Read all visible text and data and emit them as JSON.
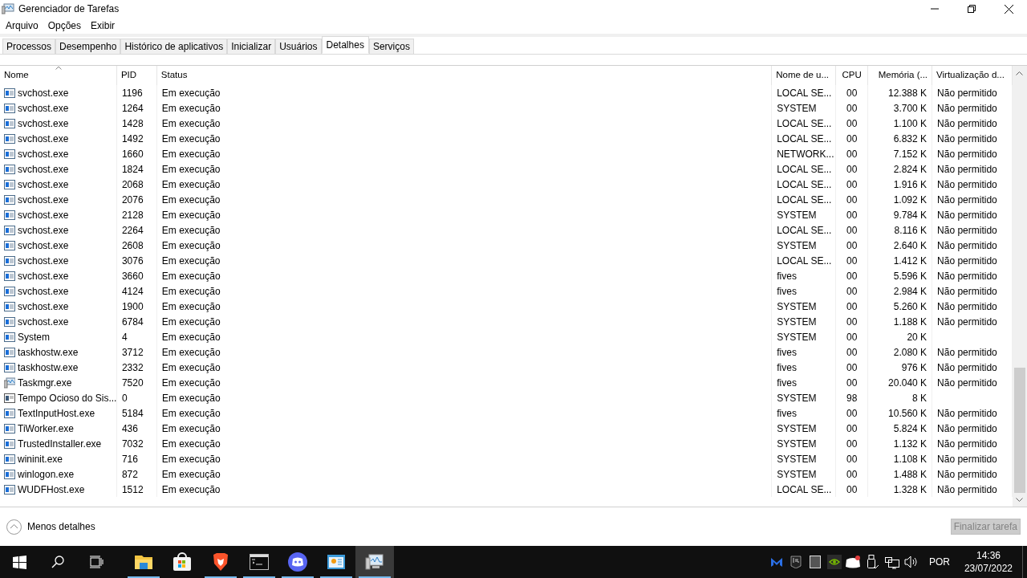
{
  "window": {
    "title": "Gerenciador de Tarefas"
  },
  "menu": [
    "Arquivo",
    "Opções",
    "Exibir"
  ],
  "tabs": [
    {
      "label": "Processos",
      "selected": false
    },
    {
      "label": "Desempenho",
      "selected": false
    },
    {
      "label": "Histórico de aplicativos",
      "selected": false
    },
    {
      "label": "Inicializar",
      "selected": false
    },
    {
      "label": "Usuários",
      "selected": false
    },
    {
      "label": "Detalhes",
      "selected": true
    },
    {
      "label": "Serviços",
      "selected": false
    }
  ],
  "table": {
    "columns": [
      "Nome",
      "PID",
      "Status",
      "Nome de u...",
      "CPU",
      "Memória (...",
      "Virtualização d..."
    ],
    "rows": [
      {
        "kind": "app",
        "cells": [
          "svchost.exe",
          "1196",
          "Em execução",
          "LOCAL SE...",
          "00",
          "12.388 K",
          "Não permitido"
        ]
      },
      {
        "kind": "app",
        "cells": [
          "svchost.exe",
          "1264",
          "Em execução",
          "SYSTEM",
          "00",
          "3.700 K",
          "Não permitido"
        ]
      },
      {
        "kind": "app",
        "cells": [
          "svchost.exe",
          "1428",
          "Em execução",
          "LOCAL SE...",
          "00",
          "1.100 K",
          "Não permitido"
        ]
      },
      {
        "kind": "app",
        "cells": [
          "svchost.exe",
          "1492",
          "Em execução",
          "LOCAL SE...",
          "00",
          "6.832 K",
          "Não permitido"
        ]
      },
      {
        "kind": "app",
        "cells": [
          "svchost.exe",
          "1660",
          "Em execução",
          "NETWORK...",
          "00",
          "7.152 K",
          "Não permitido"
        ]
      },
      {
        "kind": "app",
        "cells": [
          "svchost.exe",
          "1824",
          "Em execução",
          "LOCAL SE...",
          "00",
          "2.824 K",
          "Não permitido"
        ]
      },
      {
        "kind": "app",
        "cells": [
          "svchost.exe",
          "2068",
          "Em execução",
          "LOCAL SE...",
          "00",
          "1.916 K",
          "Não permitido"
        ]
      },
      {
        "kind": "app",
        "cells": [
          "svchost.exe",
          "2076",
          "Em execução",
          "LOCAL SE...",
          "00",
          "1.092 K",
          "Não permitido"
        ]
      },
      {
        "kind": "app",
        "cells": [
          "svchost.exe",
          "2128",
          "Em execução",
          "SYSTEM",
          "00",
          "9.784 K",
          "Não permitido"
        ]
      },
      {
        "kind": "app",
        "cells": [
          "svchost.exe",
          "2264",
          "Em execução",
          "LOCAL SE...",
          "00",
          "8.116 K",
          "Não permitido"
        ]
      },
      {
        "kind": "app",
        "cells": [
          "svchost.exe",
          "2608",
          "Em execução",
          "SYSTEM",
          "00",
          "2.640 K",
          "Não permitido"
        ]
      },
      {
        "kind": "app",
        "cells": [
          "svchost.exe",
          "3076",
          "Em execução",
          "LOCAL SE...",
          "00",
          "1.412 K",
          "Não permitido"
        ]
      },
      {
        "kind": "app",
        "cells": [
          "svchost.exe",
          "3660",
          "Em execução",
          "fives",
          "00",
          "5.596 K",
          "Não permitido"
        ]
      },
      {
        "kind": "app",
        "cells": [
          "svchost.exe",
          "4124",
          "Em execução",
          "fives",
          "00",
          "2.984 K",
          "Não permitido"
        ]
      },
      {
        "kind": "app",
        "cells": [
          "svchost.exe",
          "1900",
          "Em execução",
          "SYSTEM",
          "00",
          "5.260 K",
          "Não permitido"
        ]
      },
      {
        "kind": "app",
        "cells": [
          "svchost.exe",
          "6784",
          "Em execução",
          "SYSTEM",
          "00",
          "1.188 K",
          "Não permitido"
        ]
      },
      {
        "kind": "app",
        "cells": [
          "System",
          "4",
          "Em execução",
          "SYSTEM",
          "00",
          "20 K",
          ""
        ]
      },
      {
        "kind": "app",
        "cells": [
          "taskhostw.exe",
          "3712",
          "Em execução",
          "fives",
          "00",
          "2.080 K",
          "Não permitido"
        ]
      },
      {
        "kind": "app",
        "cells": [
          "taskhostw.exe",
          "2332",
          "Em execução",
          "fives",
          "00",
          "976 K",
          "Não permitido"
        ]
      },
      {
        "kind": "monitor",
        "cells": [
          "Taskmgr.exe",
          "7520",
          "Em execução",
          "fives",
          "00",
          "20.040 K",
          "Não permitido"
        ]
      },
      {
        "kind": "idle",
        "cells": [
          "Tempo Ocioso do Sis...",
          "0",
          "Em execução",
          "SYSTEM",
          "98",
          "8 K",
          ""
        ]
      },
      {
        "kind": "app",
        "cells": [
          "TextInputHost.exe",
          "5184",
          "Em execução",
          "fives",
          "00",
          "10.560 K",
          "Não permitido"
        ]
      },
      {
        "kind": "app",
        "cells": [
          "TiWorker.exe",
          "436",
          "Em execução",
          "SYSTEM",
          "00",
          "5.824 K",
          "Não permitido"
        ]
      },
      {
        "kind": "app",
        "cells": [
          "TrustedInstaller.exe",
          "7032",
          "Em execução",
          "SYSTEM",
          "00",
          "1.132 K",
          "Não permitido"
        ]
      },
      {
        "kind": "app",
        "cells": [
          "wininit.exe",
          "716",
          "Em execução",
          "SYSTEM",
          "00",
          "1.108 K",
          "Não permitido"
        ]
      },
      {
        "kind": "app",
        "cells": [
          "winlogon.exe",
          "872",
          "Em execução",
          "SYSTEM",
          "00",
          "1.488 K",
          "Não permitido"
        ]
      },
      {
        "kind": "app",
        "cells": [
          "WUDFHost.exe",
          "1512",
          "Em execução",
          "LOCAL SE...",
          "00",
          "1.328 K",
          "Não permitido"
        ]
      }
    ]
  },
  "footer": {
    "toggle": "Menos detalhes",
    "end_task": {
      "label": "Finalizar tarefa",
      "disabled": true
    }
  },
  "taskbar": {
    "apps": [
      {
        "kind": "folder",
        "running": true,
        "active": false
      },
      {
        "kind": "store",
        "running": false,
        "active": false
      },
      {
        "kind": "lion",
        "running": true,
        "active": false
      },
      {
        "kind": "terminal",
        "running": true,
        "active": false
      },
      {
        "kind": "chat",
        "running": true,
        "active": false
      },
      {
        "kind": "panel",
        "running": true,
        "active": false
      },
      {
        "kind": "monitor",
        "running": true,
        "active": true
      }
    ],
    "language": "POR",
    "time": "14:36",
    "date": "23/07/2022"
  }
}
